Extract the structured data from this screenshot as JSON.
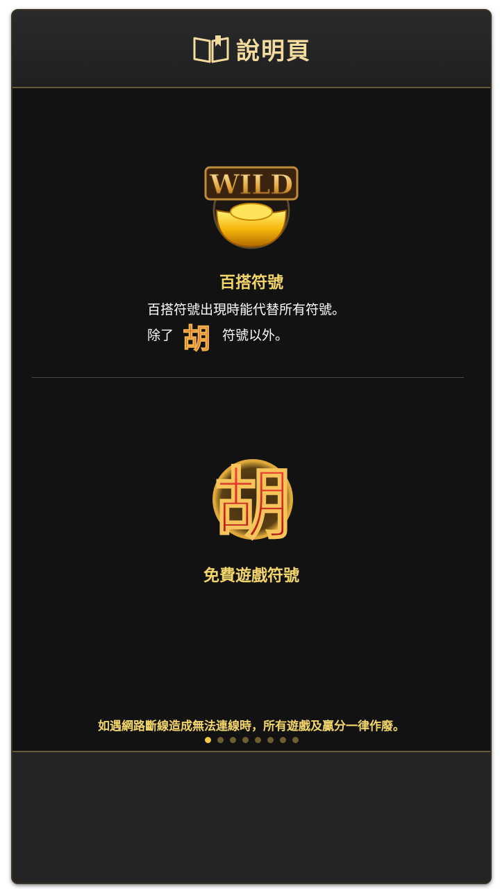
{
  "header": {
    "title": "說明頁",
    "icon": "book-icon"
  },
  "wild_section": {
    "icon": "wild-gold-ingot-icon",
    "icon_text": "WILD",
    "title": "百搭符號",
    "desc_line1": "百搭符號出現時能代替所有符號。",
    "desc_line2_prefix": "除了",
    "desc_line2_icon": "hu-symbol-icon",
    "desc_line2_suffix": "符號以外。"
  },
  "free_game_section": {
    "icon": "hu-symbol-icon",
    "icon_text": "胡",
    "title": "免費遊戲符號"
  },
  "notice": "如遇網路斷線造成無法連線時，所有遊戲及贏分一律作廢。",
  "pagination": {
    "total": 8,
    "current": 1
  },
  "colors": {
    "accent_gold": "#f3d56b",
    "header_gold": "#f3dca0",
    "background": "#121212",
    "symbol_red": "#d8231f"
  }
}
